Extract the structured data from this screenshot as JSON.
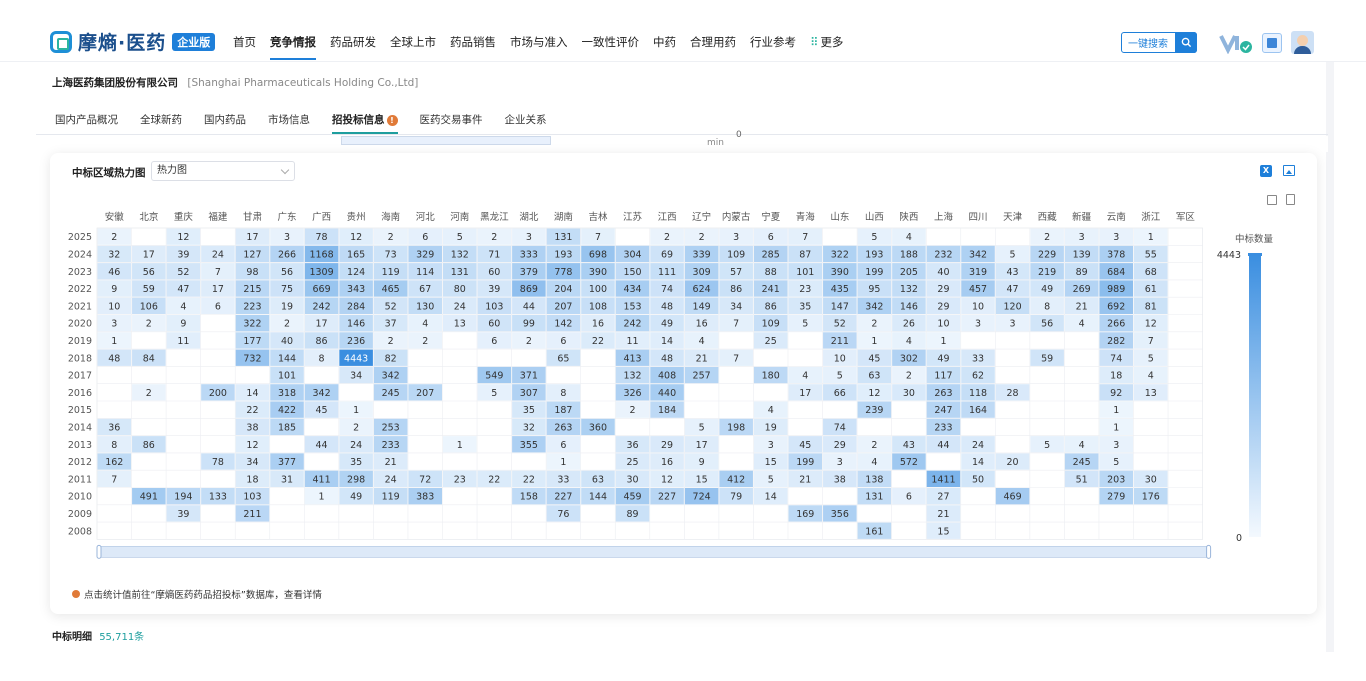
{
  "header": {
    "logo_text": "摩熵·医药",
    "logo_badge": "企业版",
    "nav": [
      {
        "label": "首页",
        "active": false
      },
      {
        "label": "竞争情报",
        "active": true
      },
      {
        "label": "药品研发",
        "active": false
      },
      {
        "label": "全球上市",
        "active": false
      },
      {
        "label": "药品销售",
        "active": false
      },
      {
        "label": "市场与准入",
        "active": false
      },
      {
        "label": "一致性评价",
        "active": false
      },
      {
        "label": "中药",
        "active": false
      },
      {
        "label": "合理用药",
        "active": false
      },
      {
        "label": "行业参考",
        "active": false
      },
      {
        "label": "更多",
        "active": false
      }
    ],
    "search_label": "一键搜索"
  },
  "company": {
    "name_cn": "上海医药集团股份有限公司",
    "name_en": "[Shanghai Pharmaceuticals Holding Co.,Ltd]"
  },
  "tabs": [
    {
      "label": "国内产品概况",
      "active": false
    },
    {
      "label": "全球新药",
      "active": false
    },
    {
      "label": "国内药品",
      "active": false
    },
    {
      "label": "市场信息",
      "active": false
    },
    {
      "label": "招投标信息",
      "active": true,
      "badge": "!"
    },
    {
      "label": "医药交易事件",
      "active": false
    },
    {
      "label": "企业关系",
      "active": false
    }
  ],
  "strip": {
    "min_label": "min",
    "zero_label": "0"
  },
  "card": {
    "title": "中标区域热力图",
    "select_value": "热力图",
    "excel_label": "X",
    "note": "点击统计值前往“摩熵医药药品招投标”数据库，查看详情"
  },
  "chart_data": {
    "type": "heatmap",
    "columns": [
      "安徽",
      "北京",
      "重庆",
      "福建",
      "甘肃",
      "广东",
      "广西",
      "贵州",
      "海南",
      "河北",
      "河南",
      "黑龙江",
      "湖北",
      "湖南",
      "吉林",
      "江苏",
      "江西",
      "辽宁",
      "内蒙古",
      "宁夏",
      "青海",
      "山东",
      "山西",
      "陕西",
      "上海",
      "四川",
      "天津",
      "西藏",
      "新疆",
      "云南",
      "浙江",
      "军区"
    ],
    "rows": [
      "2025",
      "2024",
      "2023",
      "2022",
      "2021",
      "2020",
      "2019",
      "2018",
      "2017",
      "2016",
      "2015",
      "2014",
      "2013",
      "2012",
      "2011",
      "2010",
      "2009",
      "2008"
    ],
    "values": [
      [
        2,
        null,
        12,
        null,
        17,
        3,
        78,
        12,
        2,
        6,
        5,
        2,
        3,
        131,
        7,
        null,
        2,
        2,
        3,
        6,
        7,
        null,
        5,
        4,
        null,
        null,
        null,
        2,
        3,
        3,
        1,
        null
      ],
      [
        32,
        17,
        39,
        24,
        127,
        266,
        1168,
        165,
        73,
        329,
        132,
        71,
        333,
        193,
        698,
        304,
        69,
        339,
        109,
        285,
        87,
        322,
        193,
        188,
        232,
        342,
        5,
        229,
        139,
        378,
        55,
        null
      ],
      [
        46,
        56,
        52,
        7,
        98,
        56,
        1309,
        124,
        119,
        114,
        131,
        60,
        379,
        778,
        390,
        150,
        111,
        309,
        57,
        88,
        101,
        390,
        199,
        205,
        40,
        319,
        43,
        219,
        89,
        684,
        68,
        null
      ],
      [
        9,
        59,
        47,
        17,
        215,
        75,
        669,
        343,
        465,
        67,
        80,
        39,
        869,
        204,
        100,
        434,
        74,
        624,
        86,
        241,
        23,
        435,
        95,
        132,
        29,
        457,
        47,
        49,
        269,
        989,
        61,
        null
      ],
      [
        10,
        106,
        4,
        6,
        223,
        19,
        242,
        284,
        52,
        130,
        24,
        103,
        44,
        207,
        108,
        153,
        48,
        149,
        34,
        86,
        35,
        147,
        342,
        146,
        29,
        10,
        120,
        8,
        21,
        692,
        81,
        null
      ],
      [
        3,
        2,
        9,
        null,
        322,
        2,
        17,
        146,
        37,
        4,
        13,
        60,
        99,
        142,
        16,
        242,
        49,
        16,
        7,
        109,
        5,
        52,
        2,
        26,
        10,
        3,
        3,
        56,
        4,
        266,
        12,
        null
      ],
      [
        1,
        null,
        11,
        null,
        177,
        40,
        86,
        236,
        2,
        2,
        null,
        6,
        2,
        6,
        22,
        11,
        14,
        4,
        null,
        25,
        null,
        211,
        1,
        4,
        1,
        null,
        null,
        null,
        null,
        282,
        7,
        null
      ],
      [
        48,
        84,
        null,
        null,
        732,
        144,
        8,
        4443,
        82,
        null,
        null,
        null,
        null,
        65,
        null,
        413,
        48,
        21,
        7,
        null,
        null,
        10,
        45,
        302,
        49,
        33,
        null,
        59,
        null,
        74,
        5,
        null
      ],
      [
        null,
        null,
        null,
        null,
        null,
        101,
        null,
        34,
        342,
        null,
        null,
        549,
        371,
        null,
        null,
        132,
        408,
        257,
        null,
        180,
        4,
        5,
        63,
        2,
        117,
        62,
        null,
        null,
        null,
        18,
        4,
        null
      ],
      [
        null,
        2,
        null,
        200,
        14,
        318,
        342,
        null,
        245,
        207,
        null,
        5,
        307,
        8,
        null,
        326,
        440,
        null,
        null,
        null,
        17,
        66,
        12,
        30,
        263,
        118,
        28,
        null,
        null,
        92,
        13,
        null
      ],
      [
        null,
        null,
        null,
        null,
        22,
        422,
        45,
        1,
        null,
        null,
        null,
        null,
        35,
        187,
        null,
        2,
        184,
        null,
        null,
        4,
        null,
        null,
        239,
        null,
        247,
        164,
        null,
        null,
        null,
        1,
        null,
        null
      ],
      [
        36,
        null,
        null,
        null,
        38,
        185,
        null,
        2,
        253,
        null,
        null,
        null,
        32,
        263,
        360,
        null,
        null,
        5,
        198,
        19,
        null,
        74,
        null,
        null,
        233,
        null,
        null,
        null,
        null,
        1,
        null,
        null
      ],
      [
        8,
        86,
        null,
        null,
        12,
        null,
        44,
        24,
        233,
        null,
        1,
        null,
        355,
        6,
        null,
        36,
        29,
        17,
        null,
        3,
        45,
        29,
        2,
        43,
        44,
        24,
        null,
        5,
        4,
        3,
        null,
        null
      ],
      [
        162,
        null,
        null,
        78,
        34,
        377,
        null,
        35,
        21,
        null,
        null,
        null,
        null,
        1,
        null,
        25,
        16,
        9,
        null,
        15,
        199,
        3,
        4,
        572,
        null,
        14,
        20,
        null,
        245,
        5,
        null,
        null
      ],
      [
        7,
        null,
        null,
        null,
        18,
        31,
        411,
        298,
        24,
        72,
        23,
        22,
        22,
        33,
        63,
        30,
        12,
        15,
        412,
        5,
        21,
        38,
        138,
        null,
        1411,
        50,
        null,
        null,
        51,
        203,
        30,
        null
      ],
      [
        null,
        491,
        194,
        133,
        103,
        null,
        1,
        49,
        119,
        383,
        null,
        null,
        158,
        227,
        144,
        459,
        227,
        724,
        79,
        14,
        null,
        null,
        131,
        6,
        27,
        null,
        469,
        null,
        null,
        279,
        176,
        null
      ],
      [
        null,
        null,
        39,
        null,
        211,
        null,
        null,
        null,
        null,
        null,
        null,
        null,
        null,
        76,
        null,
        89,
        null,
        null,
        null,
        null,
        169,
        356,
        null,
        null,
        21,
        null,
        null,
        null,
        null,
        null,
        null,
        null
      ],
      [
        null,
        null,
        null,
        null,
        null,
        null,
        null,
        null,
        null,
        null,
        null,
        null,
        null,
        null,
        null,
        null,
        null,
        null,
        null,
        null,
        null,
        null,
        161,
        null,
        15,
        null,
        null,
        null,
        null,
        null,
        null,
        null
      ]
    ],
    "legend_title": "中标数量",
    "legend_max": "4443",
    "legend_min": "0",
    "color_scale": [
      "#f4f9fe",
      "#3a8ee0"
    ]
  },
  "footer": {
    "label": "中标明细",
    "count": "55,711条"
  }
}
